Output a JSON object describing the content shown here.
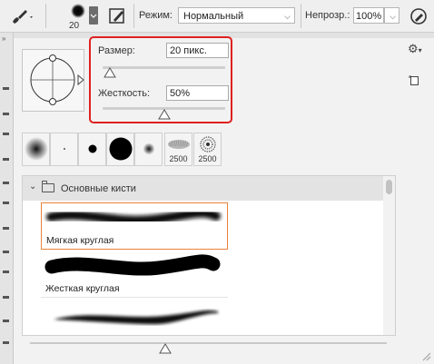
{
  "options_bar": {
    "brush_size_value": "20",
    "mode_label": "Режим:",
    "mode_value": "Нормальный",
    "opacity_label": "Непрозр.:",
    "opacity_value": "100%"
  },
  "panel": {
    "size_label": "Размер:",
    "size_value": "20 пикс.",
    "hardness_label": "Жесткость:",
    "hardness_value": "50%",
    "size_slider_fraction": 0.06,
    "hardness_slider_fraction": 0.5,
    "presets": [
      {
        "icon": "soft-round-brush-preset",
        "label": ""
      },
      {
        "icon": "tiny-dot-brush-preset",
        "label": ""
      },
      {
        "icon": "small-hard-round-preset",
        "label": ""
      },
      {
        "icon": "large-hard-round-preset",
        "label": ""
      },
      {
        "icon": "small-soft-round-preset",
        "label": ""
      },
      {
        "icon": "chalk-brush-preset",
        "label": "2500"
      },
      {
        "icon": "scatter-brush-preset",
        "label": "2500"
      }
    ],
    "group_name": "Основные кисти",
    "brushes": [
      {
        "name": "Мягкая круглая",
        "selected": true
      },
      {
        "name": "Жесткая круглая",
        "selected": false
      },
      {
        "name": "",
        "selected": false
      }
    ],
    "zoom_slider_fraction": 0.38
  },
  "colors": {
    "highlight_frame": "#e02020",
    "selected_item_border": "#e8823b"
  }
}
